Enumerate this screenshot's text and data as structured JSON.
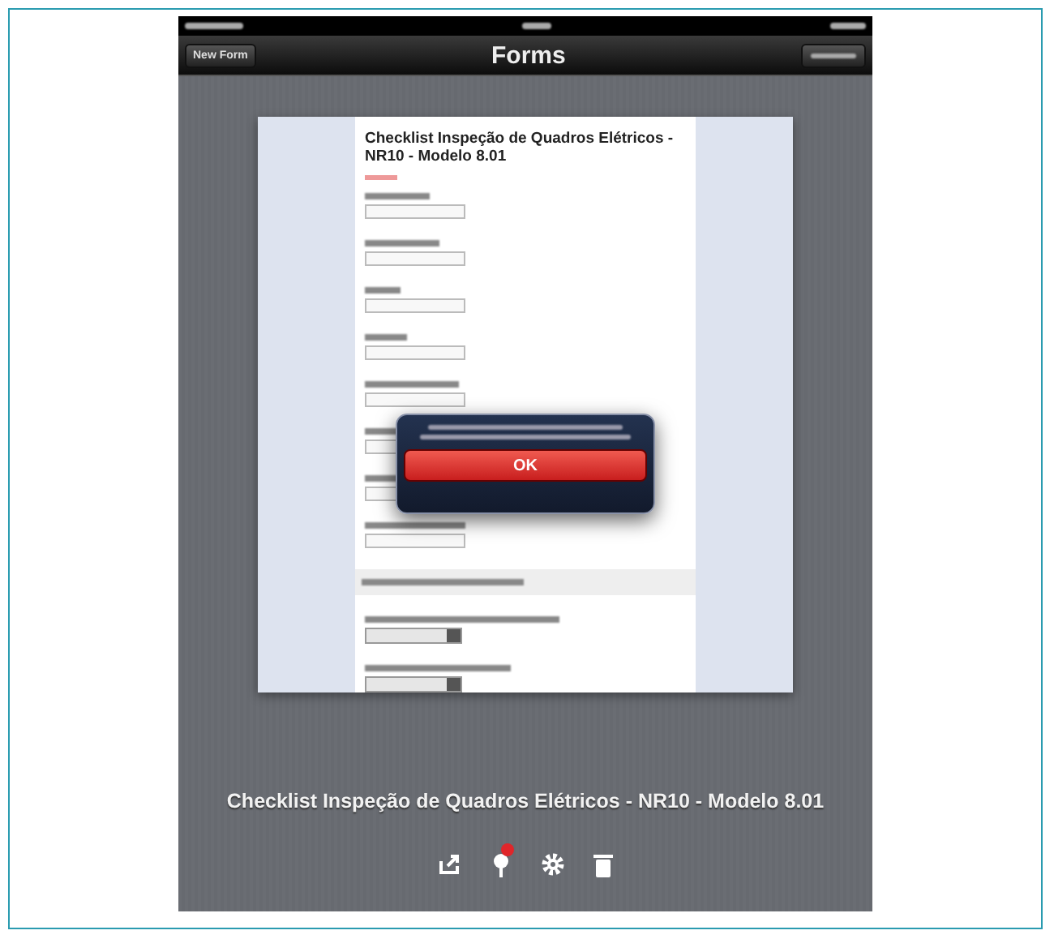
{
  "nav_bar": {
    "title": "Forms",
    "left_button": "New Form"
  },
  "document": {
    "title": "Checklist Inspeção de Quadros Elétricos - NR10 - Modelo 8.01"
  },
  "alert": {
    "button": "OK"
  },
  "form_caption": "Checklist Inspeção de Quadros Elétricos - NR10 - Modelo 8.01",
  "toolbar": {
    "badge": true
  }
}
